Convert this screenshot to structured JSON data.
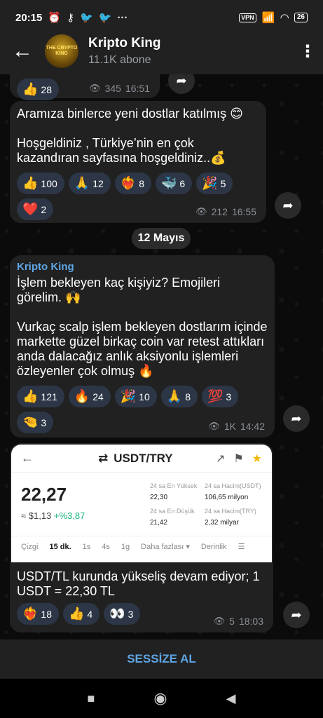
{
  "status_bar": {
    "time": "20:15",
    "vpn": "VPN",
    "battery": "26"
  },
  "header": {
    "title": "Kripto King",
    "subtitle": "11.1K abone",
    "avatar_text": "THE CRYPTO KING"
  },
  "messages": {
    "m0": {
      "reactions": [
        {
          "emoji": "👍",
          "count": "28"
        }
      ],
      "views": "345",
      "time": "16:51"
    },
    "m1": {
      "line1": "Aramıza binlerce yeni dostlar katılmış 😊",
      "line2": "Hoşgeldiniz , Türkiye’nin en çok kazandıran sayfasına hoşgeldiniz..💰",
      "reactions": [
        {
          "emoji": "👍",
          "count": "100"
        },
        {
          "emoji": "🙏",
          "count": "12"
        },
        {
          "emoji": "❤️‍🔥",
          "count": "8"
        },
        {
          "emoji": "🐳",
          "count": "6"
        },
        {
          "emoji": "🎉",
          "count": "5"
        },
        {
          "emoji": "❤️",
          "count": "2"
        }
      ],
      "views": "212",
      "time": "16:55"
    },
    "date_chip": "12 Mayıs",
    "m2": {
      "sender": "Kripto King",
      "line1": "İşlem bekleyen kaç kişiyiz? Emojileri görelim. 🙌",
      "line2": "Vurkaç scalp işlem bekleyen dostlarım içinde markette güzel birkaç coin var retest attıkları anda dalacağız anlık aksiyonlu işlemleri özleyenler çok olmuş 🔥",
      "reactions": [
        {
          "emoji": "👍",
          "count": "121"
        },
        {
          "emoji": "🔥",
          "count": "24"
        },
        {
          "emoji": "🎉",
          "count": "10"
        },
        {
          "emoji": "🙏",
          "count": "8"
        },
        {
          "emoji": "💯",
          "count": "3"
        },
        {
          "emoji": "🤏",
          "count": "3"
        }
      ],
      "views": "1K",
      "time": "14:42"
    },
    "m3": {
      "screenshot": {
        "pair": "USDT/TRY",
        "price": "22,27",
        "approx": "≈ $1,13",
        "change": "+%3,87",
        "high_label": "24 sa En Yüksek",
        "high_value": "22,30",
        "vol_usdt_label": "24 sa Hacim(USDT)",
        "vol_usdt_value": "106,65 milyon",
        "low_label": "24 sa En Düşük",
        "low_value": "21,42",
        "vol_try_label": "24 sa Hacim(TRY)",
        "vol_try_value": "2,32 milyar",
        "tabs": [
          "Çizgi",
          "15 dk.",
          "1s",
          "4s",
          "1g",
          "Daha fazlası ▾",
          "Derinlik"
        ]
      },
      "text": "USDT/TL kurunda yükseliş devam ediyor; 1 USDT = 22,30 TL",
      "reactions": [
        {
          "emoji": "❤️‍🔥",
          "count": "18"
        },
        {
          "emoji": "👍",
          "count": "4"
        },
        {
          "emoji": "👀",
          "count": "3"
        }
      ],
      "views": "5",
      "time": "18:03"
    }
  },
  "bottom": {
    "mute_label": "SESSİZE AL"
  }
}
